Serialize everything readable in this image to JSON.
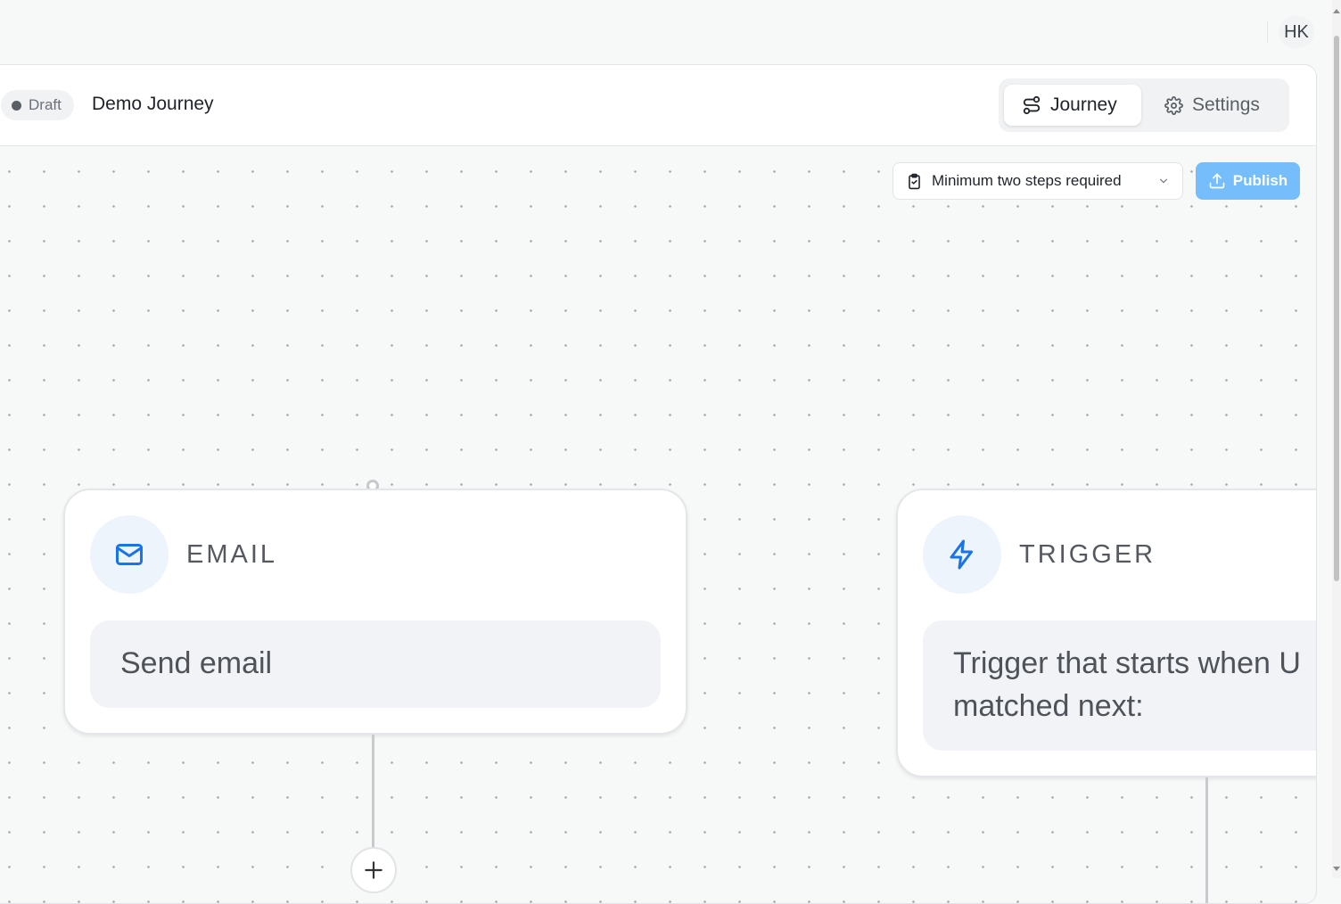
{
  "user": {
    "initials": "HK"
  },
  "header": {
    "status_badge": "Draft",
    "journey_name": "Demo Journey",
    "tabs": [
      {
        "label": "Journey",
        "icon": "route-icon",
        "active": true
      },
      {
        "label": "Settings",
        "icon": "gear-icon",
        "active": false
      }
    ]
  },
  "toolbar": {
    "validation_label": "Minimum two steps required",
    "publish_label": "Publish",
    "publish_color": "#75bdfb"
  },
  "nodes": [
    {
      "type": "EMAIL",
      "icon": "mail-icon",
      "description": "Send email"
    },
    {
      "type": "TRIGGER",
      "icon": "lightning-icon",
      "description_line1": "Trigger that starts when U",
      "description_line2": "matched next:"
    }
  ],
  "colors": {
    "accent": "#1a73e8",
    "canvas_bg": "#f7f8f8"
  }
}
